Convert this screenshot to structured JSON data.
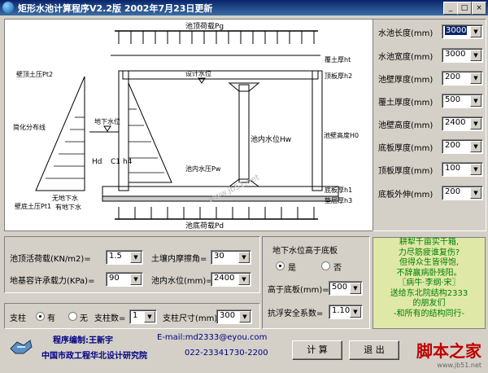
{
  "window": {
    "title": "矩形水池计算程序V2.2版    2002年7月23日更新",
    "minimize": "_",
    "maximize": "□",
    "close": "×"
  },
  "drawing": {
    "top_load": "池顶荷载Pg",
    "soil_surface": "覆土厚ht",
    "top_slab": "顶板厚h2",
    "wall_soil_pressure_top": "壁顶土压Pt2",
    "design_water_level": "设计水位",
    "simplified_distribution": "简化分布线",
    "groundwater_level": "地下水位",
    "inner_water_level": "池内水位Hw",
    "pool_net_height": "池壁高度H0",
    "inner_water_pressure": "池内水压Pw",
    "hd_label": "Hd",
    "c1_label": "C1",
    "h4_label": "h4",
    "with_groundwater": "无地下水",
    "without_groundwater": "有地下水",
    "wall_bottom_soil_pressure": "壁底土压Pt1",
    "bottom_slab": "底板厚h1",
    "cushion": "垫层厚h3",
    "bottom_load": "池底荷载Pd",
    "site_watermark": "www.jb51.net"
  },
  "params": [
    {
      "label": "水池长度(mm)",
      "value": "3000"
    },
    {
      "label": "水池宽度(mm)",
      "value": "3000"
    },
    {
      "label": "池壁厚度(mm)",
      "value": "200"
    },
    {
      "label": "覆土厚度(mm)",
      "value": "500"
    },
    {
      "label": "池壁高度(mm)",
      "value": "2400"
    },
    {
      "label": "底板厚度(mm)",
      "value": "200"
    },
    {
      "label": "顶板厚度(mm)",
      "value": "100"
    },
    {
      "label": "底板外伸(mm)",
      "value": "200"
    }
  ],
  "loads": {
    "live_load_label": "池顶活荷载(KN/m2)=",
    "live_load_value": "1.5",
    "friction_label": "土壤内摩擦角=",
    "friction_value": "30",
    "bearing_label": "地基容许承载力(KPa)=",
    "bearing_value": "90",
    "water_level_label": "池内水位(mm)=",
    "water_level_value": "2400"
  },
  "column": {
    "label": "支柱",
    "yes": "有",
    "no": "无",
    "count_label": "支柱数=",
    "count_value": "1",
    "size_label": "支柱尺寸(mm)",
    "size_value": "300"
  },
  "groundwater": {
    "question": "地下水位高于底板",
    "yes": "是",
    "no": "否",
    "height_label": "高于底板(mm)=",
    "height_value": "500",
    "safety_label": "抗浮安全系数=",
    "safety_value": "1.10"
  },
  "poem": [
    "耕犁千亩实千箱,",
    "力尽筋疲谁复伤?",
    "但得众生皆得饱,",
    "不辞赢病卧残阳。",
    "〖病牛·李纲·宋〗",
    "送给东北院结构2333",
    "的朋友们",
    "-和所有的结构同行-"
  ],
  "footer": {
    "author": "程序编制:王新宇",
    "email": "E-mail:md2333@eyou.com",
    "org": "中国市政工程华北设计研究院",
    "phone": "022-23341730-2200",
    "calc_button": "计 算",
    "exit_button": "退 出"
  },
  "watermark": {
    "brand": "脚本之家",
    "url": "www.jb51.net"
  }
}
